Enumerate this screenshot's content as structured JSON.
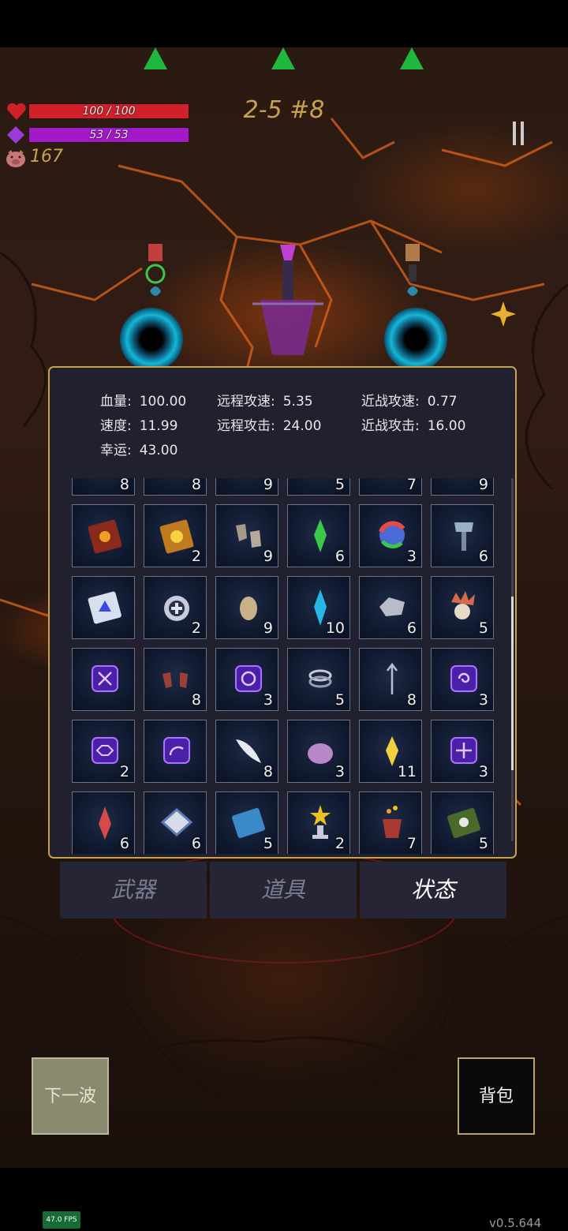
{
  "hud": {
    "hp_text": "100 / 100",
    "hp_fraction": 1.0,
    "mp_text": "53 / 53",
    "mp_fraction": 1.0,
    "coins": "167",
    "wave": "2-5 #8",
    "colors": {
      "hp": "#d0202a",
      "mp": "#a21ac8",
      "wave_text": "#c9a34a",
      "spawn_arrow": "#1fb83c"
    }
  },
  "stats": [
    {
      "label": "血量:",
      "value": "100.00"
    },
    {
      "label": "远程攻速:",
      "value": "5.35"
    },
    {
      "label": "近战攻速:",
      "value": "0.77"
    },
    {
      "label": "速度:",
      "value": "11.99"
    },
    {
      "label": "远程攻击:",
      "value": "24.00"
    },
    {
      "label": "近战攻击:",
      "value": "16.00"
    },
    {
      "label": "幸运:",
      "value": "43.00"
    }
  ],
  "items": [
    {
      "icon": "partial-item-icon",
      "count": "8"
    },
    {
      "icon": "partial-item-icon",
      "count": "8"
    },
    {
      "icon": "partial-item-icon",
      "count": "9"
    },
    {
      "icon": "partial-item-icon",
      "count": "5"
    },
    {
      "icon": "partial-item-icon",
      "count": "7"
    },
    {
      "icon": "partial-item-icon",
      "count": "9"
    },
    {
      "icon": "red-spellbook-icon",
      "count": ""
    },
    {
      "icon": "gold-spellbook-icon",
      "count": "2"
    },
    {
      "icon": "boots-icon",
      "count": "9"
    },
    {
      "icon": "green-crystal-icon",
      "count": "6"
    },
    {
      "icon": "rainbow-orb-icon",
      "count": "3"
    },
    {
      "icon": "hammer-icon",
      "count": "6"
    },
    {
      "icon": "blue-tome-icon",
      "count": ""
    },
    {
      "icon": "medal-icon",
      "count": "2"
    },
    {
      "icon": "egg-icon",
      "count": "9"
    },
    {
      "icon": "cyan-crystal-icon",
      "count": "10"
    },
    {
      "icon": "stone-icon",
      "count": "6"
    },
    {
      "icon": "skull-icon",
      "count": "5"
    },
    {
      "icon": "rune-x-icon",
      "count": ""
    },
    {
      "icon": "gloves-icon",
      "count": "8"
    },
    {
      "icon": "rune-spiral-icon",
      "count": "3"
    },
    {
      "icon": "ring-icon",
      "count": "5"
    },
    {
      "icon": "trident-icon",
      "count": "8"
    },
    {
      "icon": "rune-swirl-icon",
      "count": "3"
    },
    {
      "icon": "rune-eye-icon",
      "count": "2"
    },
    {
      "icon": "rune-arc-icon",
      "count": ""
    },
    {
      "icon": "feather-icon",
      "count": "8"
    },
    {
      "icon": "slime-icon",
      "count": "3"
    },
    {
      "icon": "yellow-crystal-icon",
      "count": "11"
    },
    {
      "icon": "rune-cross-icon",
      "count": "3"
    },
    {
      "icon": "red-shard-icon",
      "count": "6"
    },
    {
      "icon": "tile-icon",
      "count": "6"
    },
    {
      "icon": "scroll-book-icon",
      "count": "5"
    },
    {
      "icon": "star-trophy-icon",
      "count": "2"
    },
    {
      "icon": "fire-vase-icon",
      "count": "7"
    },
    {
      "icon": "skull-book-icon",
      "count": "5"
    }
  ],
  "tabs": [
    {
      "label": "武器",
      "active": false
    },
    {
      "label": "道具",
      "active": false
    },
    {
      "label": "状态",
      "active": true
    }
  ],
  "buttons": {
    "next_wave": "下一波",
    "backpack": "背包"
  },
  "footer": {
    "fps": "47.0 FPS",
    "version": "v0.5.644"
  }
}
